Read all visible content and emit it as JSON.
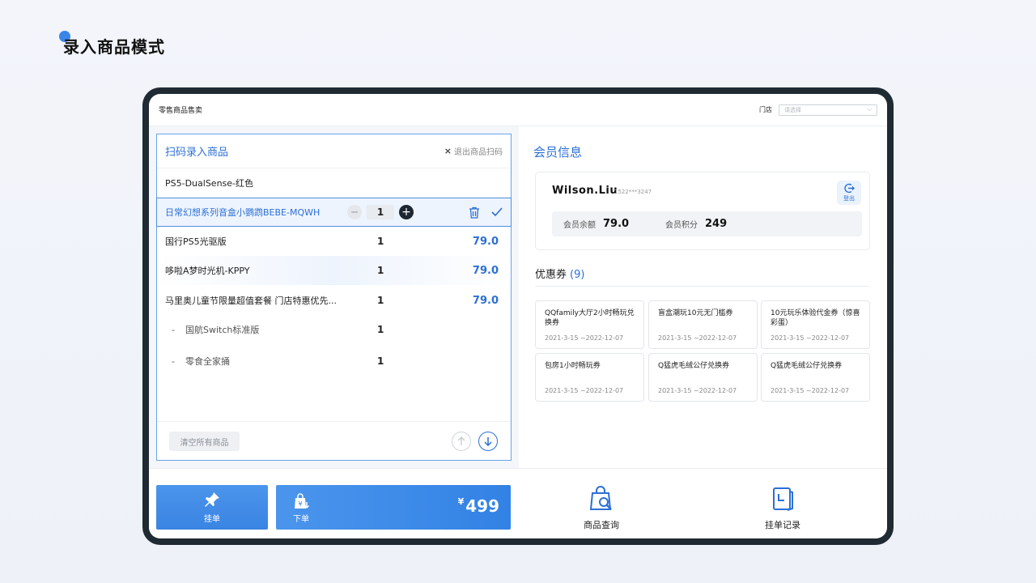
{
  "page_heading": "录入商品模式",
  "app": {
    "title": "零售商品售卖",
    "store_label": "门店",
    "store_placeholder": "请选择"
  },
  "scan": {
    "title": "扫码录入商品",
    "exit_label": "退出商品扫码",
    "items": [
      {
        "name": "PS5-DualSense-红色",
        "qty": "",
        "price": ""
      },
      {
        "name": "日常幻想系列音盒小鹦鹉BEBE-MQWH",
        "qty": "1",
        "price": ""
      },
      {
        "name": "国行PS5光驱版",
        "qty": "1",
        "price": "79.0"
      },
      {
        "name": "哆啦A梦时光机-KPPY",
        "qty": "1",
        "price": "79.0"
      },
      {
        "name": "马里奥儿童节限量超值套餐  门店特惠优先...",
        "qty": "1",
        "price": "79.0"
      },
      {
        "name": "国航Switch标准版",
        "qty": "1",
        "price": ""
      },
      {
        "name": "零食全家捅",
        "qty": "1",
        "price": ""
      }
    ],
    "sub_dash": "-",
    "clear_label": "清空所有商品"
  },
  "member": {
    "title": "会员信息",
    "name": "Wilson.Liu",
    "phone": "1522***3247",
    "logout_label": "登出",
    "balance_label": "会员余额",
    "balance_value": "79.0",
    "points_label": "会员积分",
    "points_value": "249"
  },
  "coupons": {
    "title": "优惠券",
    "count": "(9)",
    "items": [
      {
        "name": "QQfamily大厅2小时畅玩兑换券",
        "date": "2021-3-15 ~2022-12-07"
      },
      {
        "name": "盲盒潮玩10元无门槛券",
        "date": "2021-3-15 ~2022-12-07"
      },
      {
        "name": "10元玩乐体验代金券（惊喜彩蛋）",
        "date": "2021-3-15 ~2022-12-07"
      },
      {
        "name": "包房1小时畅玩券",
        "date": "2021-3-15 ~2022-12-07"
      },
      {
        "name": "Q猛虎毛绒公仔兑换券",
        "date": "2021-3-15 ~2022-12-07"
      },
      {
        "name": "Q猛虎毛绒公仔兑换券",
        "date": "2021-3-15 ~2022-12-07"
      }
    ]
  },
  "bottom": {
    "hold_label": "挂单",
    "order_label": "下单",
    "currency": "¥",
    "amount": "499",
    "query_label": "商品查询",
    "records_label": "挂单记录"
  },
  "colors": {
    "accent": "#2b6fd6",
    "button_blue": "#3a84e3",
    "device_frame": "#1f2a33"
  }
}
